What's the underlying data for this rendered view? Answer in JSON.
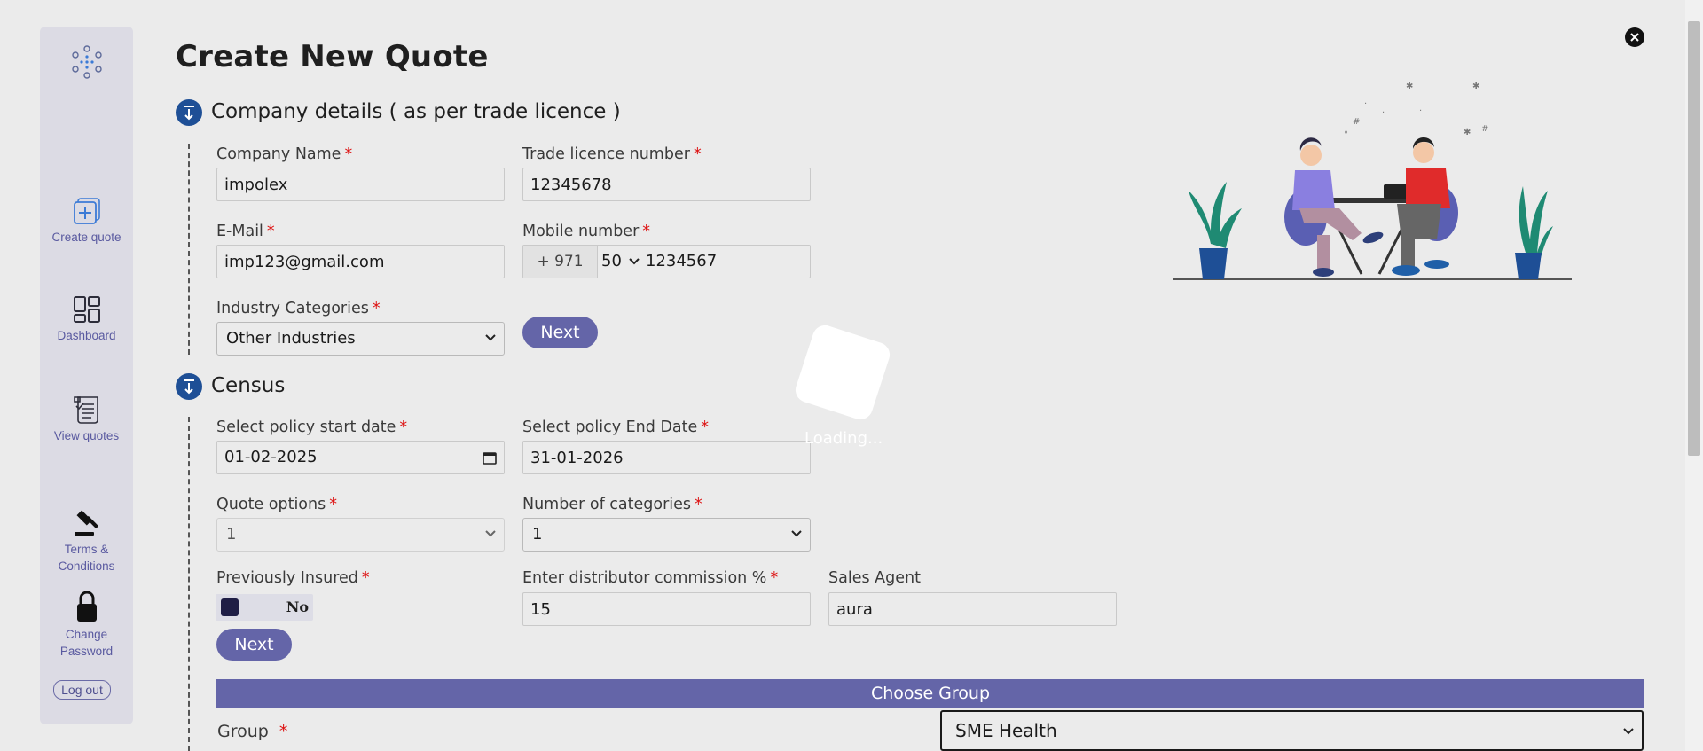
{
  "sidebar": {
    "nav": [
      {
        "label": "Create quote",
        "icon": "create-quote-icon"
      },
      {
        "label": "Dashboard",
        "icon": "dashboard-icon"
      },
      {
        "label": "View quotes",
        "icon": "view-quotes-icon"
      },
      {
        "label": "Terms & Conditions",
        "icon": "gavel-icon"
      },
      {
        "label": "Change Password",
        "icon": "lock-icon"
      }
    ],
    "logout_label": "Log out"
  },
  "page": {
    "title": "Create New Quote"
  },
  "company_section": {
    "title": "Company details ( as per trade licence )",
    "company_name": {
      "label": "Company Name",
      "value": "impolex"
    },
    "trade_licence": {
      "label": "Trade licence number",
      "value": "12345678"
    },
    "email": {
      "label": "E-Mail",
      "value": "imp123@gmail.com"
    },
    "mobile": {
      "label": "Mobile number",
      "country_code": "+ 971",
      "prefix": "50",
      "value": "1234567"
    },
    "industry": {
      "label": "Industry Categories",
      "value": "Other Industries"
    },
    "next_label": "Next"
  },
  "census_section": {
    "title": "Census",
    "start_date": {
      "label": "Select policy start date",
      "value": "01-02-2025"
    },
    "end_date": {
      "label": "Select policy End Date",
      "value": "31-01-2026"
    },
    "quote_options": {
      "label": "Quote options",
      "value": "1"
    },
    "num_categories": {
      "label": "Number of categories",
      "value": "1"
    },
    "previously_insured": {
      "label": "Previously Insured",
      "value": "No"
    },
    "commission": {
      "label": "Enter distributor commission %",
      "value": "15"
    },
    "sales_agent": {
      "label": "Sales Agent",
      "value": "aura"
    },
    "next_label": "Next"
  },
  "group_section": {
    "bar_label": "Choose Group",
    "group_label": "Group",
    "group_value": "SME Health"
  },
  "required_mark": "*",
  "loader": {
    "text": "Loading..."
  },
  "colors": {
    "accent": "#6465a8",
    "step_icon": "#1e4f96",
    "required": "#dd1111",
    "sidebar_bg": "#dcdbe4",
    "page_bg": "#ebebeb"
  }
}
